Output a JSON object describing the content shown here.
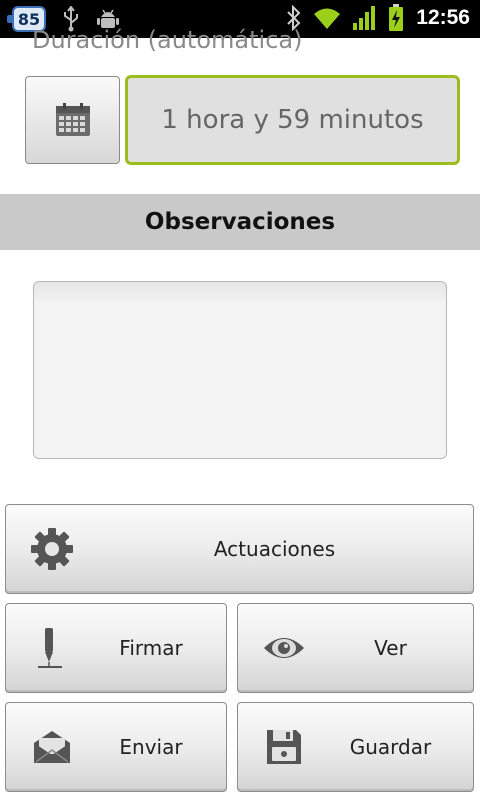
{
  "statusbar": {
    "notification_count": "85",
    "time": "12:56"
  },
  "duration": {
    "label": "Duración (automática)",
    "value": "1 hora y 59 minutos"
  },
  "observations": {
    "header": "Observaciones",
    "text": ""
  },
  "buttons": {
    "actuaciones": "Actuaciones",
    "firmar": "Firmar",
    "ver": "Ver",
    "enviar": "Enviar",
    "guardar": "Guardar"
  },
  "icons": {
    "calendar": "calendar-icon",
    "actuaciones": "gear-icon",
    "firmar": "pen-icon",
    "ver": "eye-icon",
    "enviar": "mail-icon",
    "guardar": "floppy-disk-icon"
  },
  "colors": {
    "field_focus_border": "#9dbd1e",
    "section_header_bg": "#c9c9c9",
    "statusbar_bg": "#000000",
    "battery_wifi_green": "#9bcf1a"
  }
}
